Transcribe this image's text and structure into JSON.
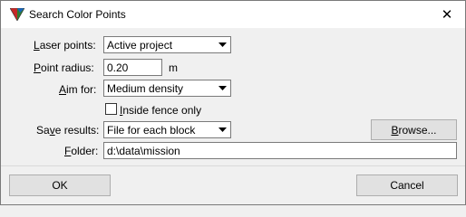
{
  "window": {
    "title": "Search Color Points"
  },
  "fields": {
    "laser_points": {
      "label_u": "L",
      "label_rest": "aser points:",
      "value": "Active project"
    },
    "point_radius": {
      "label_u": "P",
      "label_rest": "oint radius:",
      "value": "0.20",
      "unit": "m"
    },
    "aim_for": {
      "label_pre": "",
      "label_u": "A",
      "label_rest": "im for:",
      "value": "Medium density"
    },
    "inside_fence": {
      "label_u": "I",
      "label_rest": "nside fence only",
      "checked": false
    },
    "save_results": {
      "label_pre": "Sa",
      "label_u": "v",
      "label_rest": "e results:",
      "value": "File for each block"
    },
    "folder": {
      "label_u": "F",
      "label_rest": "older:",
      "value": "d:\\data\\mission"
    }
  },
  "buttons": {
    "browse": {
      "label_u": "B",
      "label_rest": "rowse..."
    },
    "ok": "OK",
    "cancel": "Cancel"
  }
}
